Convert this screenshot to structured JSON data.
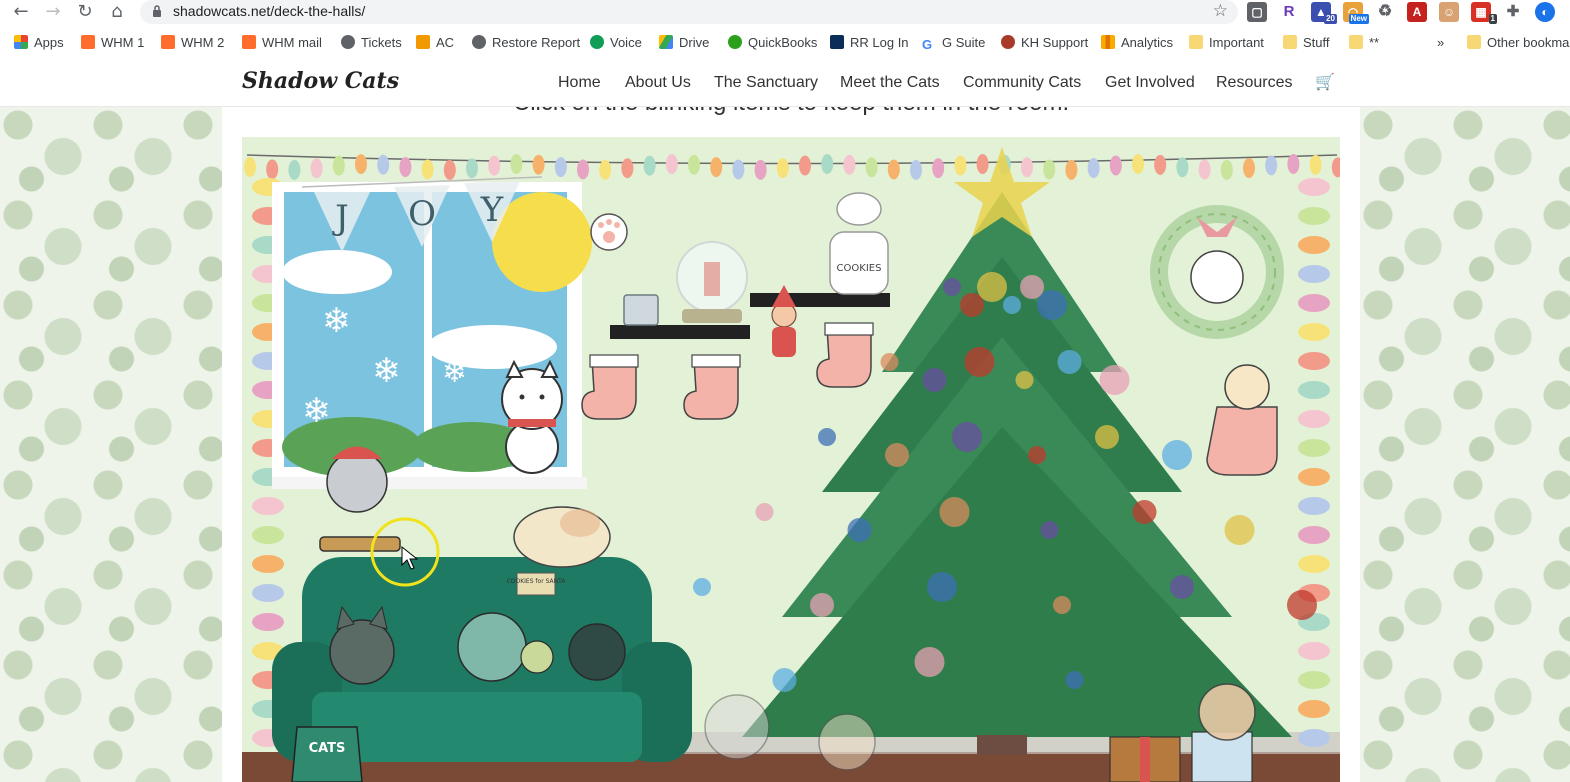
{
  "browser": {
    "url": "shadowcats.net/deck-the-halls/",
    "bookmarks": [
      "Apps",
      "WHM 1",
      "WHM 2",
      "WHM mail",
      "Tickets",
      "AC",
      "Restore Report",
      "Voice",
      "Drive",
      "QuickBooks",
      "RR Log In",
      "G Suite",
      "KH Support",
      "Analytics",
      "Important",
      "Stuff",
      "**"
    ],
    "overflow": "»",
    "other_bookmarks": "Other bookma",
    "ext_badges": [
      "20",
      "New",
      "1"
    ]
  },
  "site": {
    "logo": "Shadow Cats",
    "nav": [
      "Home",
      "About Us",
      "The Sanctuary",
      "Meet the Cats",
      "Community Cats",
      "Get Involved",
      "Resources"
    ],
    "cart_icon": "shopping-cart-icon"
  },
  "game": {
    "instruction": "Click on the blinking items to keep them in the room.",
    "banner_letters": [
      "J",
      "O",
      "Y"
    ],
    "cookie_jar_label": "COOKIES",
    "cookie_plate_label": "COOKIES for SANTA",
    "cat_bag_label": "CATS"
  },
  "colors": {
    "wall": "#e3f2d6",
    "sofa": "#1f7a63",
    "tree": "#2e7d4a",
    "window_sky": "#7cc3e0"
  }
}
